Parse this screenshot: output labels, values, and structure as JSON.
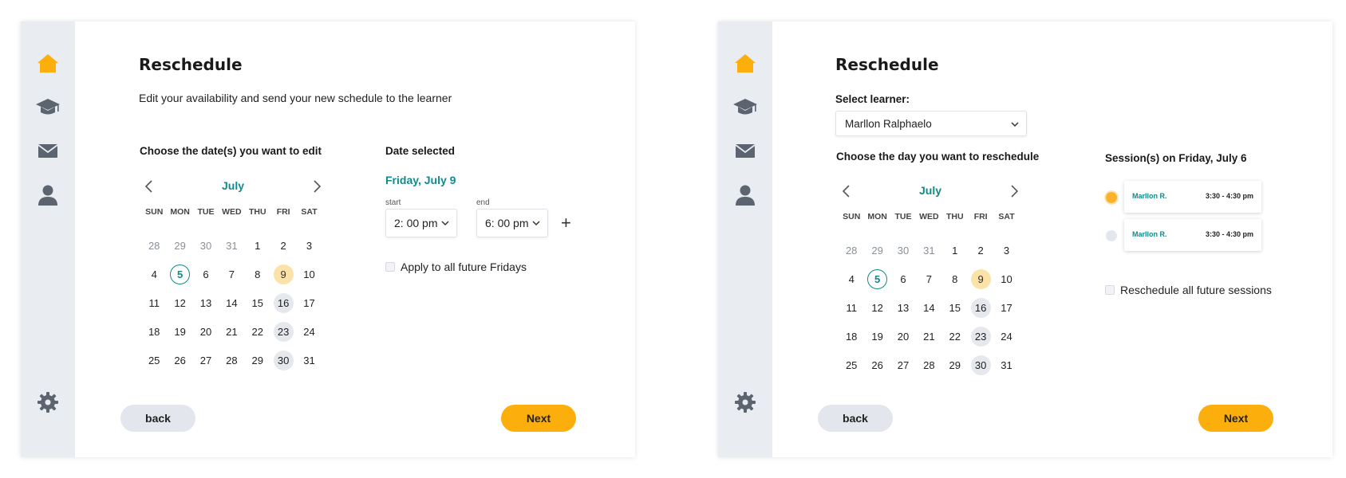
{
  "colors": {
    "accent": "#fcaf0c",
    "teal": "#138a8a",
    "sidebar": "#e9ecf1",
    "icon_gray": "#5c6470"
  },
  "nav_icons": [
    "home-icon",
    "graduation-cap-icon",
    "mail-icon",
    "user-icon",
    "gear-icon"
  ],
  "calendar": {
    "month": "July",
    "weekdays": [
      "SUN",
      "MON",
      "TUE",
      "WED",
      "THU",
      "FRI",
      "SAT"
    ],
    "days": [
      {
        "n": "28",
        "state": "muted"
      },
      {
        "n": "29",
        "state": "muted"
      },
      {
        "n": "30",
        "state": "muted"
      },
      {
        "n": "31",
        "state": "muted"
      },
      {
        "n": "1",
        "state": ""
      },
      {
        "n": "2",
        "state": ""
      },
      {
        "n": "3",
        "state": ""
      },
      {
        "n": "4",
        "state": ""
      },
      {
        "n": "5",
        "state": "today"
      },
      {
        "n": "6",
        "state": ""
      },
      {
        "n": "7",
        "state": ""
      },
      {
        "n": "8",
        "state": ""
      },
      {
        "n": "9",
        "state": "selected"
      },
      {
        "n": "10",
        "state": ""
      },
      {
        "n": "11",
        "state": ""
      },
      {
        "n": "12",
        "state": ""
      },
      {
        "n": "13",
        "state": ""
      },
      {
        "n": "14",
        "state": ""
      },
      {
        "n": "15",
        "state": ""
      },
      {
        "n": "16",
        "state": "friday"
      },
      {
        "n": "17",
        "state": ""
      },
      {
        "n": "18",
        "state": ""
      },
      {
        "n": "19",
        "state": ""
      },
      {
        "n": "20",
        "state": ""
      },
      {
        "n": "21",
        "state": ""
      },
      {
        "n": "22",
        "state": ""
      },
      {
        "n": "23",
        "state": "friday"
      },
      {
        "n": "24",
        "state": ""
      },
      {
        "n": "25",
        "state": ""
      },
      {
        "n": "26",
        "state": ""
      },
      {
        "n": "27",
        "state": ""
      },
      {
        "n": "28",
        "state": ""
      },
      {
        "n": "29",
        "state": ""
      },
      {
        "n": "30",
        "state": "friday"
      },
      {
        "n": "31",
        "state": ""
      }
    ]
  },
  "panel1": {
    "title": "Reschedule",
    "subtitle": "Edit your availability and send your new schedule to the learner",
    "choose_label": "Choose the date(s) you want to edit",
    "date_selected_label": "Date selected",
    "date_selected_value": "Friday, July 9",
    "start_label": "start",
    "start_value": "2: 00 pm",
    "end_label": "end",
    "end_value": "6: 00 pm",
    "plus": "+",
    "apply_label": "Apply to all future Fridays",
    "back_label": "back",
    "next_label": "Next"
  },
  "panel2": {
    "title": "Reschedule",
    "select_learner_label": "Select learner:",
    "learner_value": "Marllon Ralphaelo",
    "choose_label": "Choose the day you want to reschedule",
    "sessions_label": "Session(s) on Friday, July 6",
    "sessions": [
      {
        "name": "Marllon R.",
        "time": "3:30 - 4:30 pm"
      },
      {
        "name": "Marllon R.",
        "time": "3:30 - 4:30 pm"
      }
    ],
    "reschedule_all_label": "Reschedule all future sessions",
    "back_label": "back",
    "next_label": "Next"
  }
}
